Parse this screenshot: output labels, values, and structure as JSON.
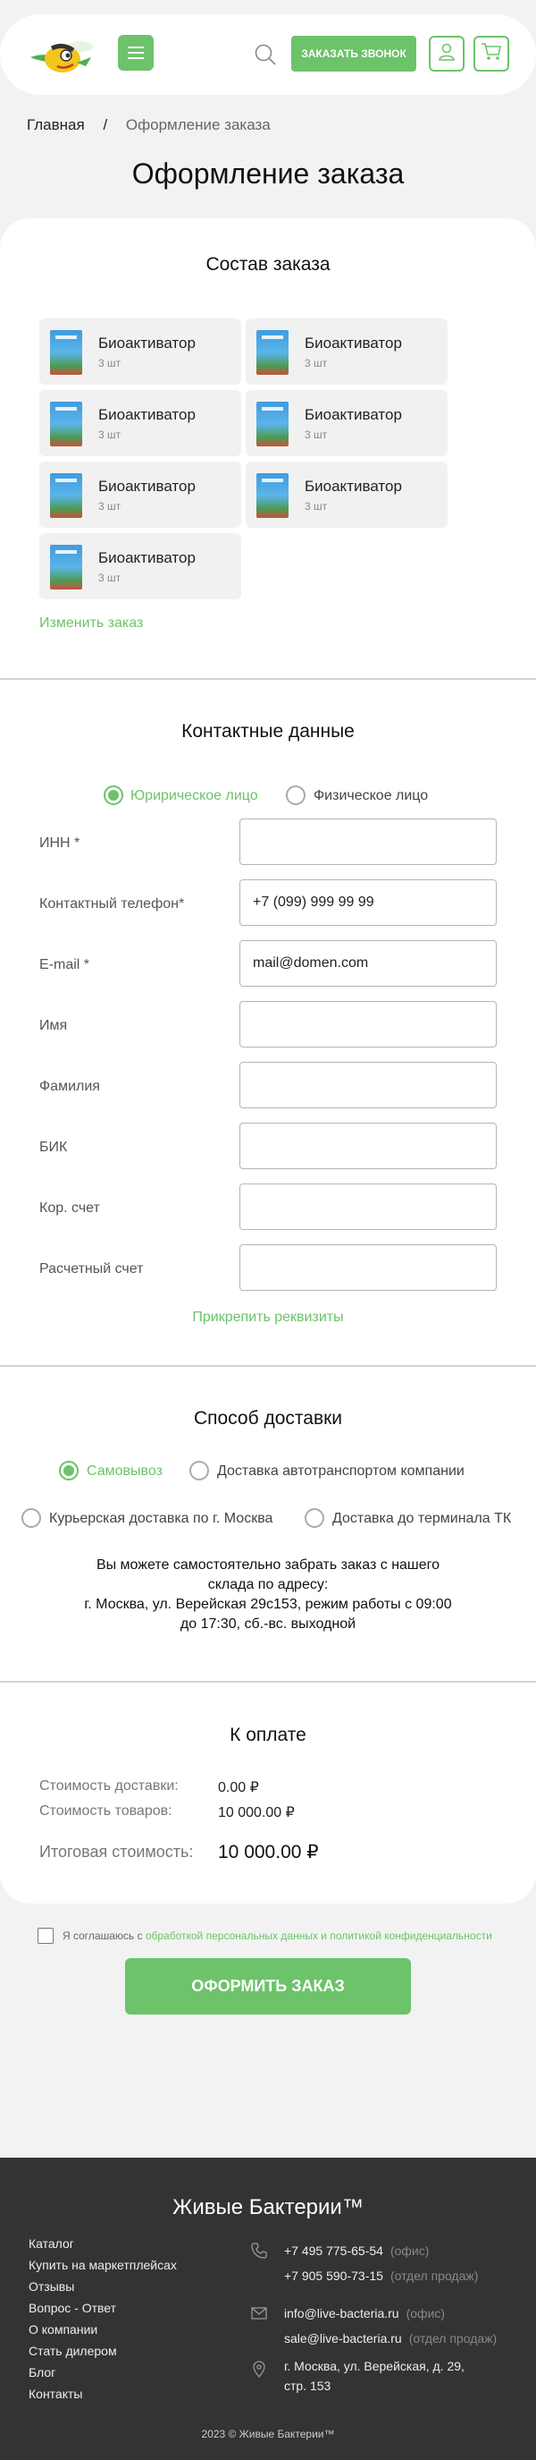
{
  "header": {
    "call_button": "ЗАКАЗАТЬ ЗВОНОК",
    "brand_color": "#6cc36a"
  },
  "breadcrumb": {
    "home": "Главная",
    "separator": "/",
    "current": "Оформление заказа"
  },
  "page_title": "Оформление заказа",
  "order": {
    "title": "Состав заказа",
    "items": [
      {
        "name": "Биоактиватор",
        "qty": "3 шт"
      },
      {
        "name": "Биоактиватор",
        "qty": "3 шт"
      },
      {
        "name": "Биоактиватор",
        "qty": "3 шт"
      },
      {
        "name": "Биоактиватор",
        "qty": "3 шт"
      },
      {
        "name": "Биоактиватор",
        "qty": "3 шт"
      },
      {
        "name": "Биоактиватор",
        "qty": "3 шт"
      },
      {
        "name": "Биоактиватор",
        "qty": "3 шт"
      }
    ],
    "change_link": "Изменить заказ"
  },
  "contacts": {
    "title": "Контактные данные",
    "type_legal": "Юририческое лицо",
    "type_person": "Физическое лицо",
    "fields": [
      {
        "label": "ИНН *",
        "value": ""
      },
      {
        "label": "Контактный телефон*",
        "value": "+7 (099) 999 99 99"
      },
      {
        "label": "E-mail *",
        "value": "mail@domen.com"
      },
      {
        "label": "Имя",
        "value": ""
      },
      {
        "label": "Фамилия",
        "value": ""
      },
      {
        "label": "БИК",
        "value": ""
      },
      {
        "label": "Кор. счет",
        "value": ""
      },
      {
        "label": "Расчетный счет",
        "value": ""
      }
    ],
    "attach_link": "Прикрепить реквизиты"
  },
  "delivery": {
    "title": "Способ доставки",
    "options": [
      "Самовывоз",
      "Доставка автотранспортом компании",
      "Курьерская доставка по г. Москва",
      "Доставка до терминала ТК"
    ],
    "selected": "Самовывоз",
    "pickup_lines": [
      "Вы можете самостоятельно забрать заказ с нашего",
      "склада по адресу:",
      "г. Москва, ул. Верейская 29с153, режим работы с 09:00",
      "до 17:30, сб.-вс. выходной"
    ]
  },
  "payment": {
    "title": "К оплате",
    "delivery_label": "Стоимость доставки:",
    "delivery_value": "0.00 ₽",
    "goods_label": "Стоимость товаров:",
    "goods_value": "10 000.00 ₽",
    "total_label": "Итоговая стоимость:",
    "total_value": "10 000.00 ₽"
  },
  "consent": {
    "prefix": "Я соглашаюсь с ",
    "link": "обработкой персональных данных и политикой конфиденциальности",
    "checked": false
  },
  "submit_button": "ОФОРМИТЬ ЗАКАЗ",
  "footer": {
    "brand": "Живые Бактерии™",
    "nav": [
      "Каталог",
      "Купить на маркетплейсах",
      "Отзывы",
      "Вопрос - Ответ",
      "О компании",
      "Стать дилером",
      "Блог",
      "Контакты"
    ],
    "phone1": "+7 495 775-65-54",
    "phone1_note": "(офис)",
    "phone2": "+7 905 590-73-15",
    "phone2_note": "(отдел продаж)",
    "email1": "info@live-bacteria.ru",
    "email1_note": "(офис)",
    "email2": "sale@live-bacteria.ru",
    "email2_note": "(отдел продаж)",
    "address_line1": "г. Москва, ул. Верейская, д. 29,",
    "address_line2": "стр. 153",
    "copyright": "2023 © Живые Бактерии™"
  }
}
